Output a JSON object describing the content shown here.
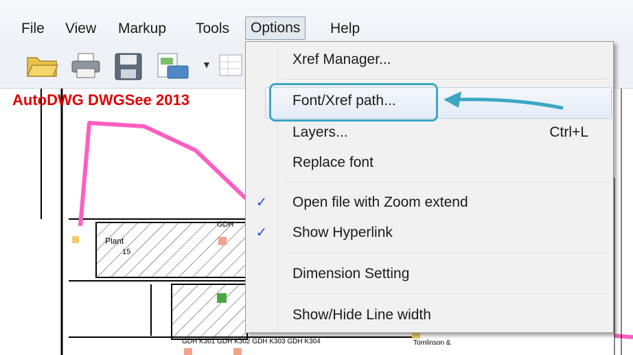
{
  "menubar": {
    "items": [
      "File",
      "View",
      "Markup",
      "Tools",
      "Options",
      "Help"
    ]
  },
  "document": {
    "title": "AutoDWG DWGSee 2013"
  },
  "options_menu": {
    "items": [
      {
        "label": "Xref Manager..."
      },
      {
        "label": "Font/Xref path..."
      },
      {
        "label": "Layers...",
        "shortcut": "Ctrl+L"
      },
      {
        "label": "Replace font"
      },
      {
        "label": "Open file with Zoom extend",
        "checked": true
      },
      {
        "label": "Show Hyperlink",
        "checked": true
      },
      {
        "label": "Dimension Setting"
      },
      {
        "label": "Show/Hide Line width"
      }
    ],
    "check_glyph": "✓"
  },
  "drawing_labels": {
    "label_1": "GDH",
    "label_2": "Plant",
    "label_3": "15",
    "label_4": "GDH K301 GDH K302 GDH K303 GDH K304",
    "label_5": "Tomlinson &"
  },
  "colors": {
    "accent_highlight": "#3ba7c4",
    "check": "#2554c7",
    "title_red": "#e00000",
    "pink_path": "#ff5ec1"
  }
}
